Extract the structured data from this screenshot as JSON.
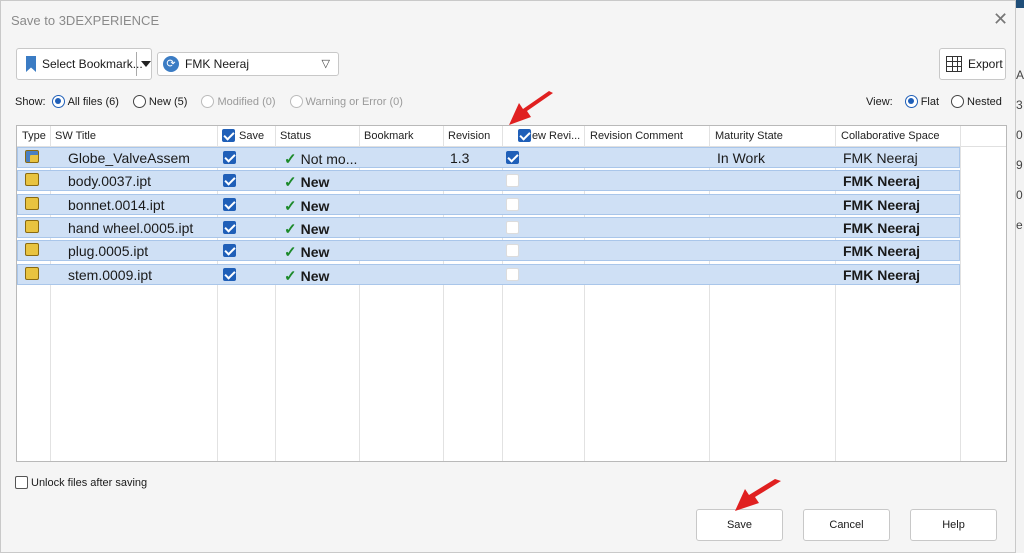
{
  "dialog": {
    "title": "Save to 3DEXPERIENCE"
  },
  "toolbar": {
    "bookmark_label": "Select Bookmark...",
    "space_label": "FMK Neeraj",
    "export_label": "Export"
  },
  "filters": {
    "show_label": "Show:",
    "options": [
      {
        "label": "All files (6)",
        "selected": true,
        "enabled": true
      },
      {
        "label": "New (5)",
        "selected": false,
        "enabled": true
      },
      {
        "label": "Modified (0)",
        "selected": false,
        "enabled": false
      },
      {
        "label": "Warning or Error (0)",
        "selected": false,
        "enabled": false
      }
    ]
  },
  "view": {
    "label": "View:",
    "options": [
      {
        "label": "Flat",
        "selected": true
      },
      {
        "label": "Nested",
        "selected": false
      }
    ]
  },
  "table": {
    "columns": [
      "Type",
      "SW Title",
      "Save",
      "Status",
      "Bookmark",
      "Revision",
      "New Revi...",
      "Revision Comment",
      "Maturity State",
      "Collaborative Space"
    ],
    "rows": [
      {
        "title": "Globe_ValveAssem",
        "type": "assembly",
        "save": true,
        "status": "Not mo...",
        "status_bold": false,
        "bookmark": "",
        "revision": "1.3",
        "new_revision": true,
        "revision_comment": "",
        "maturity": "In Work",
        "space": "FMK Neeraj",
        "space_bold": false
      },
      {
        "title": "body.0037.ipt",
        "type": "part",
        "save": true,
        "status": "New",
        "status_bold": true,
        "bookmark": "",
        "revision": "",
        "new_revision": false,
        "revision_comment": "",
        "maturity": "",
        "space": "FMK Neeraj",
        "space_bold": true
      },
      {
        "title": "bonnet.0014.ipt",
        "type": "part",
        "save": true,
        "status": "New",
        "status_bold": true,
        "bookmark": "",
        "revision": "",
        "new_revision": false,
        "revision_comment": "",
        "maturity": "",
        "space": "FMK Neeraj",
        "space_bold": true
      },
      {
        "title": "hand wheel.0005.ipt",
        "type": "part",
        "save": true,
        "status": "New",
        "status_bold": true,
        "bookmark": "",
        "revision": "",
        "new_revision": false,
        "revision_comment": "",
        "maturity": "",
        "space": "FMK Neeraj",
        "space_bold": true
      },
      {
        "title": "plug.0005.ipt",
        "type": "part",
        "save": true,
        "status": "New",
        "status_bold": true,
        "bookmark": "",
        "revision": "",
        "new_revision": false,
        "revision_comment": "",
        "maturity": "",
        "space": "FMK Neeraj",
        "space_bold": true
      },
      {
        "title": "stem.0009.ipt",
        "type": "part",
        "save": true,
        "status": "New",
        "status_bold": true,
        "bookmark": "",
        "revision": "",
        "new_revision": false,
        "revision_comment": "",
        "maturity": "",
        "space": "FMK Neeraj",
        "space_bold": true
      }
    ]
  },
  "footer": {
    "unlock_label": "Unlock files after saving",
    "unlock_checked": false,
    "save_label": "Save",
    "cancel_label": "Cancel",
    "help_label": "Help"
  },
  "background": {
    "chars": [
      "A",
      "3",
      "0",
      "9",
      "0",
      "e"
    ]
  },
  "colors": {
    "accent": "#1f5fb8",
    "row_highlight": "#cfe0f5",
    "status_ok": "#1c8a2a",
    "annotation_arrow": "#e02020"
  }
}
